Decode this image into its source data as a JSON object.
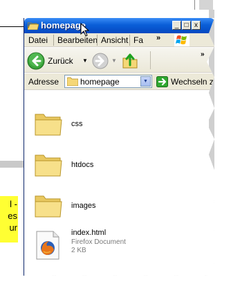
{
  "background": {
    "note_lines": [
      "l -",
      "es",
      "ur"
    ]
  },
  "window": {
    "title": "homepage",
    "caption_buttons": {
      "minimize": "_",
      "maximize": "□",
      "close": "x"
    },
    "menu": [
      "Datei",
      "Bearbeiten",
      "Ansicht",
      "Fa"
    ],
    "menu_more": "»",
    "toolbar": {
      "back_label": "Zurück",
      "dropdown_arrow": "▼",
      "more": "»"
    },
    "address": {
      "label": "Adresse",
      "value": "homepage",
      "dropdown_arrow": "▼",
      "go_label": "Wechseln zu"
    },
    "items": [
      {
        "name": "css",
        "type": "folder",
        "icon": "folder-icon"
      },
      {
        "name": "htdocs",
        "type": "folder",
        "icon": "folder-icon"
      },
      {
        "name": "images",
        "type": "folder",
        "icon": "folder-icon"
      },
      {
        "name": "index.html",
        "type": "file",
        "icon": "firefox-document-icon",
        "kind": "Firefox Document",
        "size": "2 KB"
      }
    ]
  },
  "colors": {
    "titlebar": "#0a5fd8",
    "note": "#ffff33",
    "folder": "#f5d777"
  }
}
